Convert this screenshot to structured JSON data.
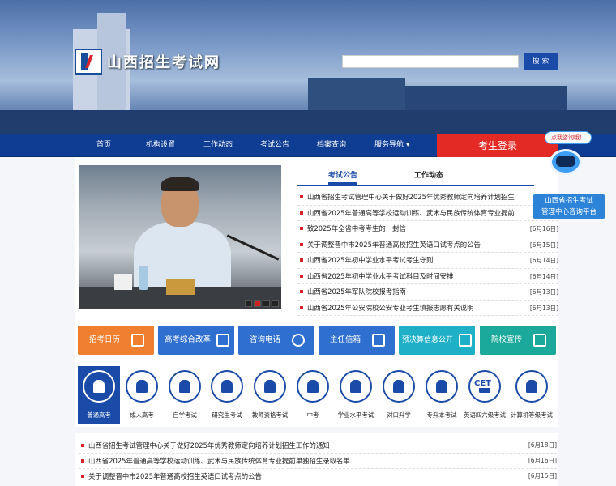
{
  "site": {
    "title": "山西招生考试网",
    "search_button": "搜 索",
    "search_placeholder": ""
  },
  "nav": {
    "items": [
      "首页",
      "机构设置",
      "工作动态",
      "考试公告",
      "档案查询",
      "服务导航"
    ],
    "login": "考生登录"
  },
  "tabs": [
    "考试公告",
    "工作动态"
  ],
  "news": [
    {
      "title": "山西省招生考试管理中心关于做好2025年优秀教师定向培养计划招生",
      "date": ""
    },
    {
      "title": "山西省2025年普通高等学校运动训练、武术与民族传统体育专业提前",
      "date": ""
    },
    {
      "title": "致2025年全省中考考生的一封信",
      "date": "[6月16日]"
    },
    {
      "title": "关于调整晋中市2025年普通高校招生英语口试考点的公告",
      "date": "[6月15日]"
    },
    {
      "title": "山西省2025年初中学业水平考试考生守则",
      "date": "[6月14日]"
    },
    {
      "title": "山西省2025年初中学业水平考试科目及时间安排",
      "date": "[6月14日]"
    },
    {
      "title": "山西省2025年军队院校报考指南",
      "date": "[6月13日]"
    },
    {
      "title": "山西省2025年公安院校公安专业考生填报志愿有关说明",
      "date": "[6月13日]"
    }
  ],
  "assistant": {
    "bubble": "点我咨询哦！",
    "line1": "山西省招生考试",
    "line2": "管理中心咨询平台"
  },
  "quick_buttons": [
    {
      "label": "招考日历",
      "color": "#f07f2f",
      "icon": "calendar-icon"
    },
    {
      "label": "高考综合改革",
      "color": "#2f6fcf",
      "icon": "reform-icon"
    },
    {
      "label": "咨询电话",
      "color": "#2f6fcf",
      "icon": "chat-icon"
    },
    {
      "label": "主任信箱",
      "color": "#2f6fcf",
      "icon": "mailbox-icon"
    },
    {
      "label": "预决算信息公开",
      "color": "#1fb0c8",
      "icon": "document-icon"
    },
    {
      "label": "院校宣传",
      "color": "#1aa99a",
      "icon": "school-icon"
    }
  ],
  "categories": [
    "普通高考",
    "成人高考",
    "自学考试",
    "研究生考试",
    "教师资格考试",
    "中考",
    "学业水平考试",
    "对口升学",
    "专升本考试",
    "英语四六级考试",
    "计算机等级考试"
  ],
  "category_icon_badge": "CET",
  "bottom_news": [
    {
      "title": "山西省招生考试管理中心关于做好2025年优秀教师定向培养计划招生工作的通知",
      "date": "[6月18日]"
    },
    {
      "title": "山西省2025年普通高等学校运动训练、武术与民族传统体育专业提前单独招生录取名单",
      "date": "[6月16日]"
    },
    {
      "title": "关于调整晋中市2025年普通高校招生英语口试考点的公告",
      "date": "[6月15日]"
    }
  ]
}
